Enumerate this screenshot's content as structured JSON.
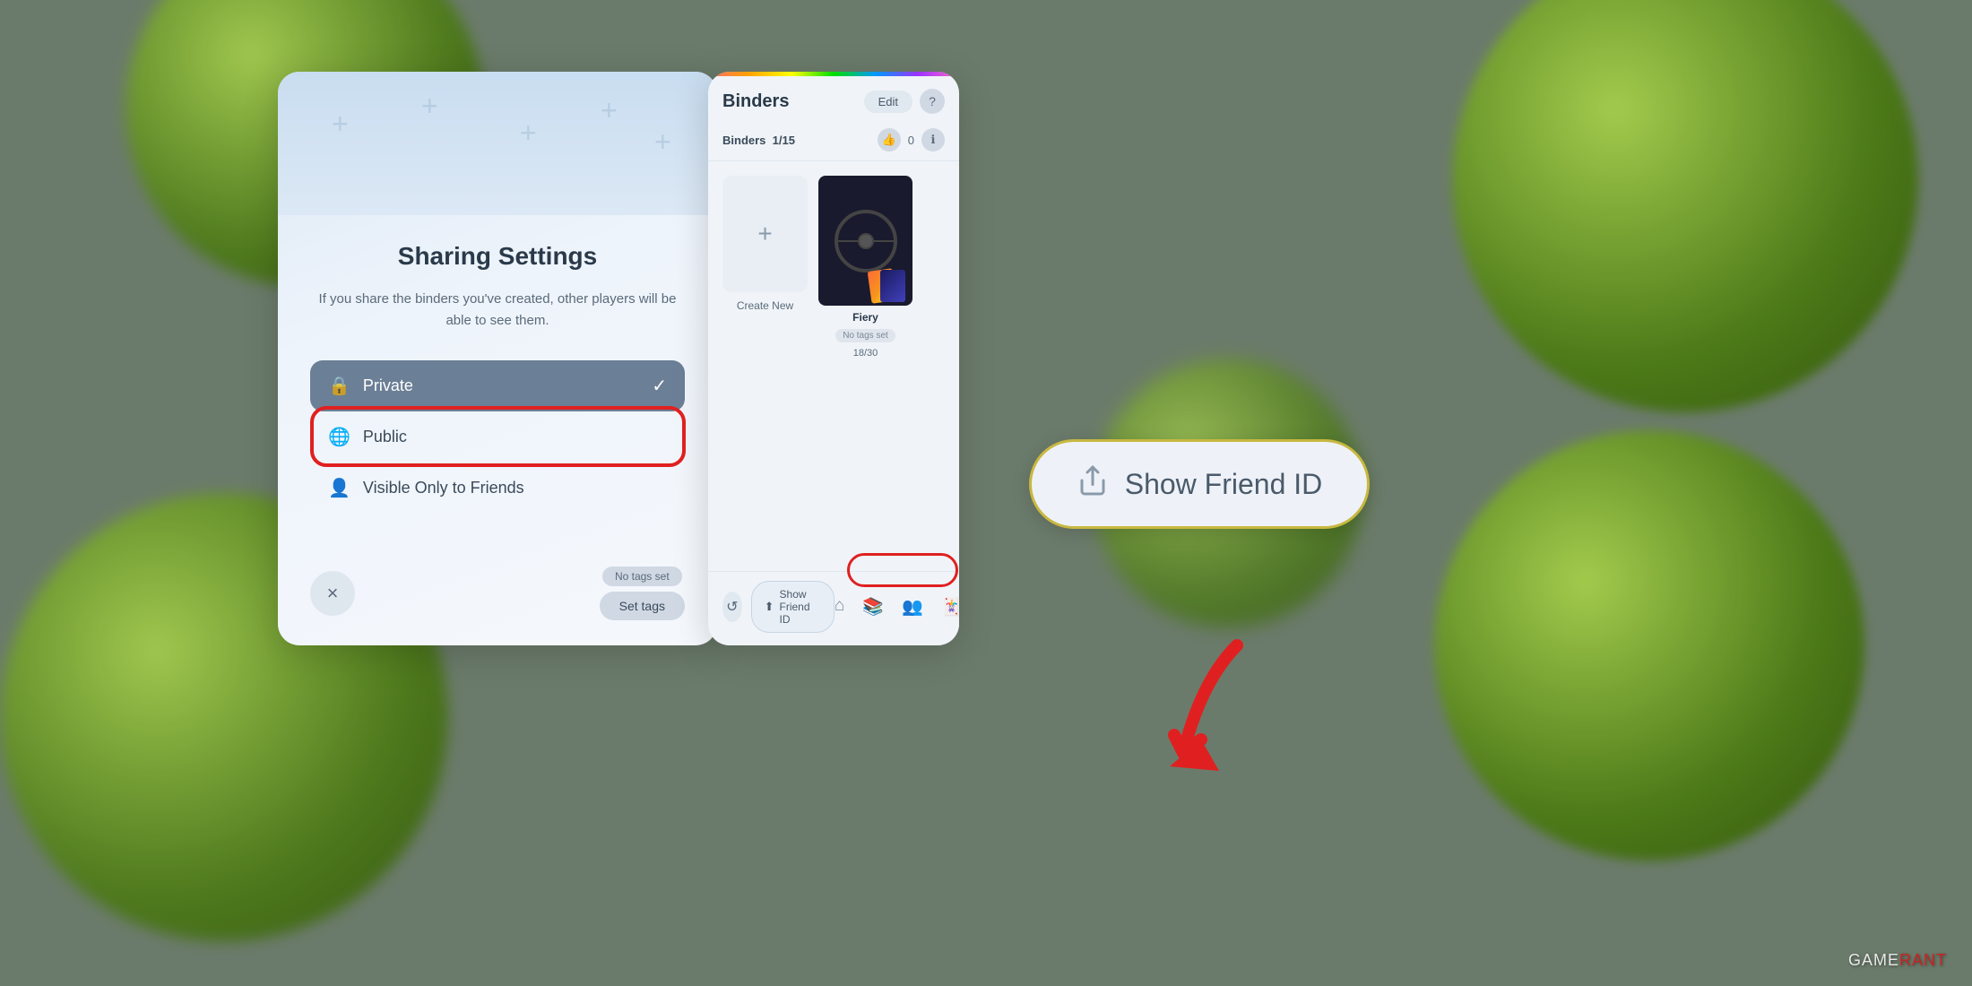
{
  "background": {
    "color": "#6b7b6b"
  },
  "left_panel": {
    "title": "Sharing Settings",
    "description": "If you share the binders you've created, other players will be able to see them.",
    "options": [
      {
        "id": "private",
        "label": "Private",
        "selected": true,
        "icon": "🔒"
      },
      {
        "id": "public",
        "label": "Public",
        "selected": false,
        "icon": "🌐"
      },
      {
        "id": "friends",
        "label": "Visible Only to Friends",
        "selected": false,
        "icon": "👤"
      }
    ],
    "close_label": "×",
    "no_tags_label": "No tags set",
    "set_tags_label": "Set tags"
  },
  "right_panel": {
    "title": "Binders",
    "edit_label": "Edit",
    "help_label": "?",
    "binders_count": "1/15",
    "likes_count": "0",
    "create_label": "Create New",
    "binder_name": "Fiery",
    "binder_tags": "No tags set",
    "binder_count": "18/30"
  },
  "show_friend_small": {
    "label": "Show Friend ID",
    "icon": "↑□"
  },
  "show_friend_large": {
    "label": "Show Friend ID"
  },
  "gamerant": {
    "prefix": "GAME",
    "suffix": "RANT"
  }
}
